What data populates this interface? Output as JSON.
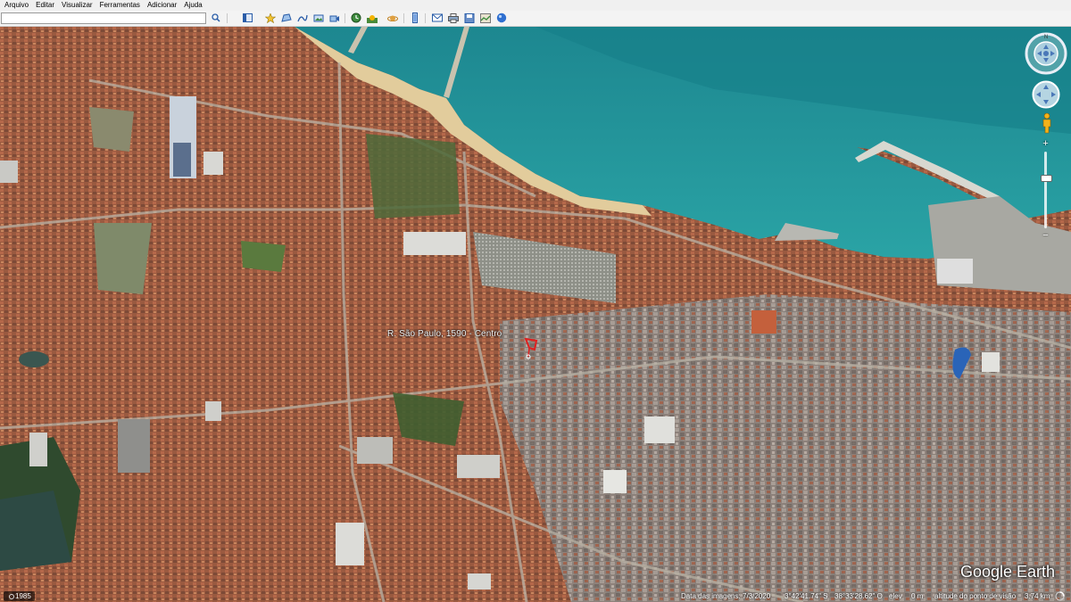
{
  "menu": {
    "items": [
      "Arquivo",
      "Editar",
      "Visualizar",
      "Ferramentas",
      "Adicionar",
      "Ajuda"
    ]
  },
  "toolbar": {
    "search_value": "",
    "search_placeholder": "",
    "icons": [
      "search-icon",
      "sidebar-toggle-icon",
      "add-placemark-icon",
      "add-polygon-icon",
      "add-path-icon",
      "add-image-overlay-icon",
      "record-tour-icon",
      "historical-imagery-icon",
      "sunlight-icon",
      "planets-icon",
      "ruler-icon",
      "email-icon",
      "print-icon",
      "save-image-icon",
      "view-in-maps-icon",
      "sign-in-icon"
    ]
  },
  "map": {
    "placemark_label": "R. São Paulo, 1590 - Centro",
    "pin_color": "#e02020"
  },
  "logo": {
    "text": "Google Earth"
  },
  "status": {
    "year": "1985",
    "imagery_date_label": "Data das imagens:",
    "imagery_date": "7/3/2020",
    "latitude": "3°42'41.74\" S",
    "longitude": "38°33'28.62\" O",
    "elevation_label": "elev",
    "elevation": "0 m",
    "eye_alt_label": "altitude do ponto de visão",
    "eye_alt": "3.74 km"
  },
  "colors": {
    "ocean_deep": "#1b8a92",
    "ocean_shallow": "#2fa6a8",
    "sand": "#e6cfa0",
    "city_roof": "#a65a3c",
    "city_mid": "#8a6050",
    "city_gray": "#8b8b88",
    "park_green": "#3e5a2f",
    "accent_blue": "#2a5da8"
  }
}
